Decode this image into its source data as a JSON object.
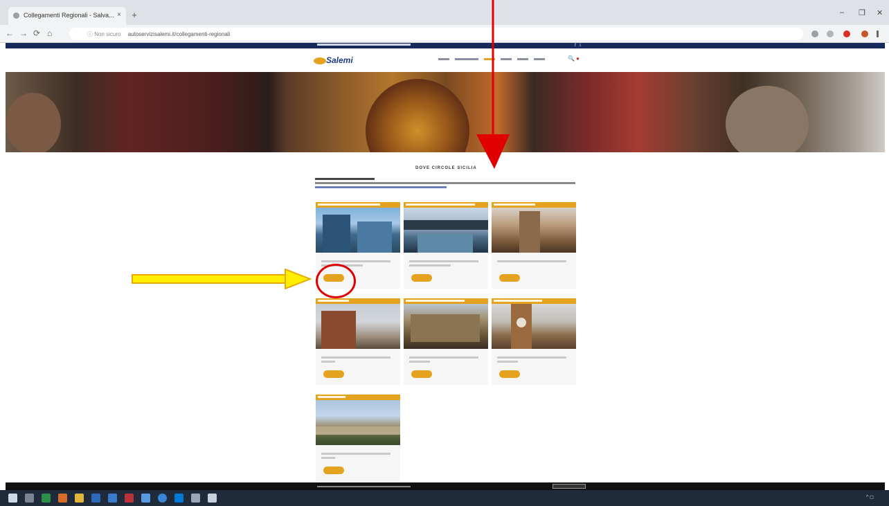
{
  "browser": {
    "tab_title": "Collegamenti Regionali - Salva...",
    "tab_close": "×",
    "new_tab": "+",
    "window_controls": {
      "minimize": "–",
      "maximize": "❐",
      "close": "✕"
    },
    "nav": {
      "back": "←",
      "forward": "→",
      "reload": "⟳",
      "home": "⌂"
    },
    "secure_label": "ⓘ Non sicuro",
    "url": "autoservizisalemi.it/collegamenti-regionali"
  },
  "site": {
    "logo_text": "Salemi",
    "social": "f  i",
    "nav_icons": "🔍 ●",
    "page_title": "DOVE CIRCOLE SICILIA",
    "cards": [
      {
        "id": 1,
        "button": ""
      },
      {
        "id": 2,
        "button": ""
      },
      {
        "id": 3,
        "button": ""
      },
      {
        "id": 4,
        "button": ""
      },
      {
        "id": 5,
        "button": ""
      },
      {
        "id": 6,
        "button": ""
      },
      {
        "id": 7,
        "button": ""
      }
    ],
    "footer_badge": ""
  },
  "taskbar": {
    "tray_text": "^ ◻"
  },
  "colors": {
    "accent": "#e5a21f",
    "navy": "#18295c",
    "annotation_red": "#e00000",
    "annotation_yellow": "#ffee00"
  }
}
